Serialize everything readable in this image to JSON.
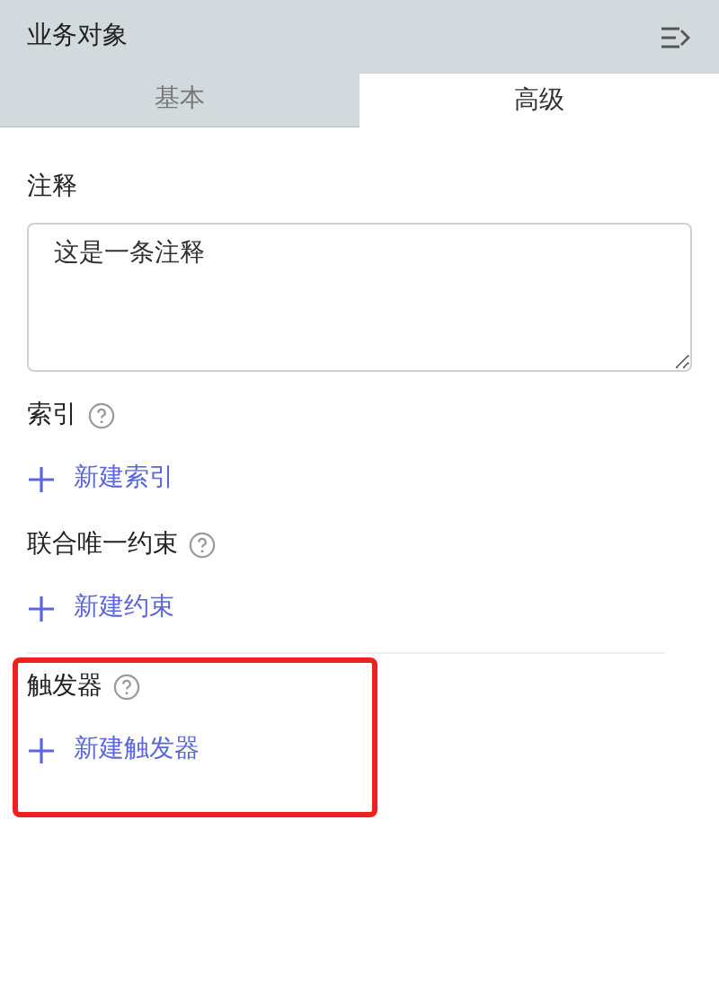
{
  "panel": {
    "title": "业务对象"
  },
  "tabs": [
    {
      "label": "基本",
      "selected": false
    },
    {
      "label": "高级",
      "selected": true
    }
  ],
  "comment": {
    "label": "注释",
    "value": "这是一条注释"
  },
  "sections": [
    {
      "label": "索引",
      "add_label": "新建索引",
      "divider_before": false,
      "highlighted": false
    },
    {
      "label": "联合唯一约束",
      "add_label": "新建约束",
      "divider_before": false,
      "highlighted": false
    },
    {
      "label": "触发器",
      "add_label": "新建触发器",
      "divider_before": true,
      "highlighted": true
    }
  ]
}
